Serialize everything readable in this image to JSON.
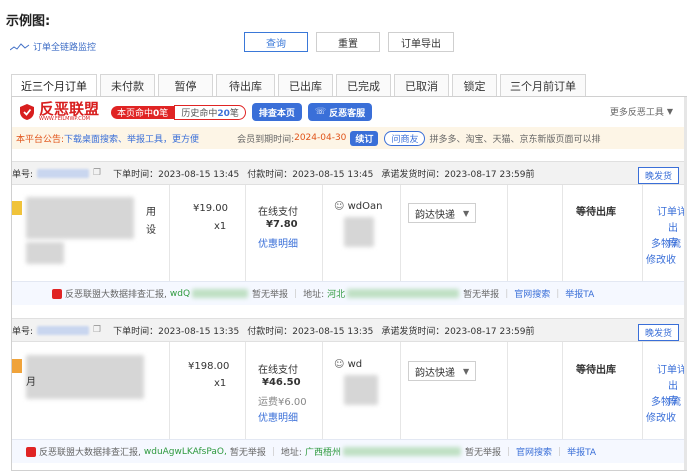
{
  "page_title": "示例图:",
  "monitor_label": "订单全链路监控",
  "top_buttons": {
    "query": "查询",
    "reset": "重置",
    "export": "订单导出"
  },
  "tabs": [
    "近三个月订单",
    "未付款",
    "暂停",
    "待出库",
    "已出库",
    "已完成",
    "已取消",
    "锁定",
    "三个月前订单"
  ],
  "toolbar": {
    "logo_text": "反恶联盟",
    "logo_sub": "WWW.FEILMWP.COM",
    "page_checked_prefix": "本页命中",
    "page_checked_count": "0",
    "page_checked_suffix": "笔",
    "history_prefix": "历史命中",
    "history_count": "20",
    "history_suffix": "笔",
    "check_page_btn": "排查本页",
    "customer_service_btn": "反恶客服",
    "more_tools": "更多反恶工具"
  },
  "notice": {
    "label": "本平台公告:",
    "links": "下载桌面搜索、举报工具，更方便",
    "member_label": "会员到期时间:",
    "member_date": "2024-04-30",
    "renew_btn": "续订",
    "ask_friend_btn": "问商友",
    "platforms_text": "拼多多、淘宝、天猫、京东新版页面可以排"
  },
  "orders": [
    {
      "order_no_label": "单号:",
      "order_time": "下单时间：2023-08-15 13:45",
      "pay_time": "付款时间：2023-08-15 13:45",
      "promise_time": "承诺发货时间：2023-08-17 23:59前",
      "late_btn": "晚发货",
      "price": "¥19.00",
      "qty": "x1",
      "product_frag": "用",
      "product_frag2": "设",
      "pay_method": "在线支付",
      "pay_amount": "¥7.80",
      "pay_extra": "",
      "discount_link": "优惠明细",
      "buyer_frag": "wdOan",
      "express": "韵达快递",
      "status": "等待出库",
      "actions": [
        "订单详",
        "出库",
        "多物流",
        "修改收"
      ],
      "footer_prefix": "反恶联盟大数据排查汇报,",
      "footer_buyer": "wdQ",
      "footer_mid": "暂无举报",
      "footer_addr_label": "地址:",
      "footer_addr": "河北",
      "footer_addr_tail": "暂无举报",
      "footer_search": "官网搜索",
      "footer_report": "举报TA"
    },
    {
      "order_no_label": "单号:",
      "order_time": "下单时间：2023-08-15 13:35",
      "pay_time": "付款时间：2023-08-15 13:35",
      "promise_time": "承诺发货时间：2023-08-17 23:59前",
      "late_btn": "晚发货",
      "price": "¥198.00",
      "qty": "x1",
      "product_frag": "月",
      "product_frag2": "",
      "pay_method": "在线支付",
      "pay_amount": "¥46.50",
      "pay_extra": "运费¥6.00",
      "discount_link": "优惠明细",
      "buyer_frag": "wd",
      "express": "韵达快递",
      "status": "等待出库",
      "actions": [
        "订单详",
        "出库",
        "多物流",
        "修改收"
      ],
      "footer_prefix": "反恶联盟大数据排查汇报,",
      "footer_buyer": "wduAgwLKAfsPaO,",
      "footer_mid": "暂无举报",
      "footer_addr_label": "地址:",
      "footer_addr": "广西梧州",
      "footer_addr_tail": "暂无举报",
      "footer_search": "官网搜索",
      "footer_report": "举报TA"
    }
  ]
}
